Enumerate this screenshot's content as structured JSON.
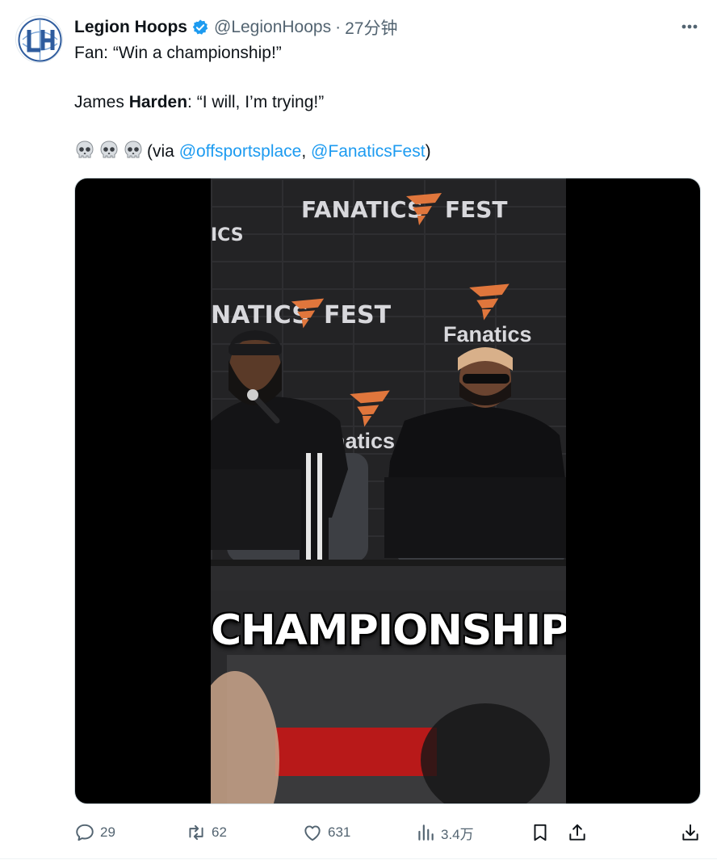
{
  "tweet": {
    "display_name": "Legion Hoops",
    "handle": "@LegionHoops",
    "separator": "·",
    "time": "27分钟",
    "line1": "Fan: “Win a championship!”",
    "line2_prefix": "James ",
    "line2_bold": "Harden",
    "line2_suffix": ": “I will, I’m trying!”",
    "line3_via": "(via ",
    "mention1": "@offsportsplace",
    "comma": ", ",
    "mention2": "@FanaticsFest",
    "line3_close": ")"
  },
  "media": {
    "signs": [
      "FANATICS",
      "FEST",
      "ICS",
      "NATICS",
      "FEST",
      "Fanatics",
      "natics"
    ],
    "caption": "CHAMPIONSHIP"
  },
  "actions": {
    "replies": "29",
    "retweets": "62",
    "likes": "631",
    "views": "3.4万"
  },
  "colors": {
    "accent": "#1d9bf0",
    "muted": "#536471",
    "fanatics_orange": "#e0763c"
  },
  "icons": [
    "verified-badge-icon",
    "more-icon",
    "skull-icon",
    "reply-icon",
    "retweet-icon",
    "like-icon",
    "views-icon",
    "bookmark-icon",
    "share-icon",
    "download-icon"
  ]
}
